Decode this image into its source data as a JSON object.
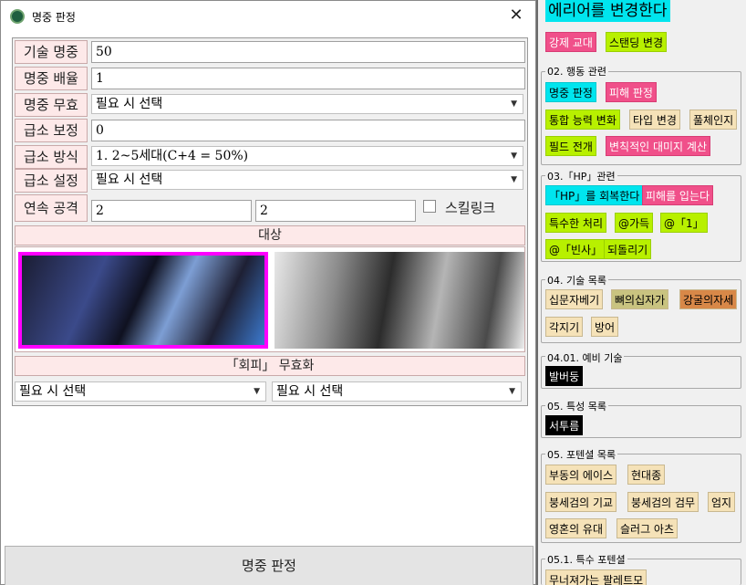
{
  "dialog": {
    "title": "명중 판정",
    "fields": {
      "skill_hit": {
        "label": "기술 명중",
        "value": "50"
      },
      "hit_mult": {
        "label": "명중 배율",
        "value": "1"
      },
      "hit_invalid": {
        "label": "명중 무효",
        "value": "필요 시 선택"
      },
      "crit_bonus": {
        "label": "급소 보정",
        "value": "0"
      },
      "crit_method": {
        "label": "급소 방식",
        "value": "1. 2~5세대(C+4 = 50%)"
      },
      "crit_setting": {
        "label": "급소 설정",
        "value": "필요 시 선택"
      },
      "combo": {
        "label": "연속 공격",
        "value1": "2",
        "value2": "2",
        "checkbox_label": "스킬링크"
      }
    },
    "target_label": "대상",
    "evasion_label": "「회피」 무효화",
    "select_left": "필요 시 선택",
    "select_right": "필요 시 선택",
    "button": "명중 판정",
    "close_icon": "close-icon"
  },
  "panel": {
    "top": {
      "big": "에리어를 변경한다",
      "tags": [
        "강제 교대",
        "스탠딩 변경"
      ]
    },
    "g02": {
      "title": "02. 행동 관련",
      "tags": [
        "명중 판정",
        "피해 판정",
        "통합 능력 변화",
        "타입 변경",
        "풀체인지",
        "필드 전개",
        "변칙적인 대미지 계산"
      ]
    },
    "g03": {
      "title": "03.「HP」관련",
      "tags": [
        "「HP」를 회복한다",
        "피해를 입는다",
        "특수한 처리",
        "@가득",
        "@「1」",
        "@「빈사」",
        "되돌리기"
      ]
    },
    "g04": {
      "title": "04. 기술 목록",
      "tags": [
        "십문자베기",
        "뼈의십자가",
        "강굴의자세",
        "각지기",
        "방어"
      ]
    },
    "g0401": {
      "title": "04.01. 예비 기술",
      "tags": [
        "발버둥"
      ]
    },
    "g05a": {
      "title": "05. 특성 목록",
      "tags": [
        "서투름"
      ]
    },
    "g05b": {
      "title": "05. 포텐셜 목록",
      "tags": [
        "부동의 에이스",
        "현대종",
        "붕세검의 기교",
        "붕세검의 검무",
        "엄지",
        "영혼의 유대",
        "슬러그 아츠"
      ]
    },
    "g051": {
      "title": "05.1. 특수 포텐셜",
      "tags": [
        "무너져가는 팔레트모"
      ]
    },
    "colors": {
      "cyan": "#00e5ee",
      "pink": "#f0508a",
      "lime": "#b8f000",
      "cream": "#f5e2b8",
      "magenta_border": "#ff00ff"
    }
  }
}
